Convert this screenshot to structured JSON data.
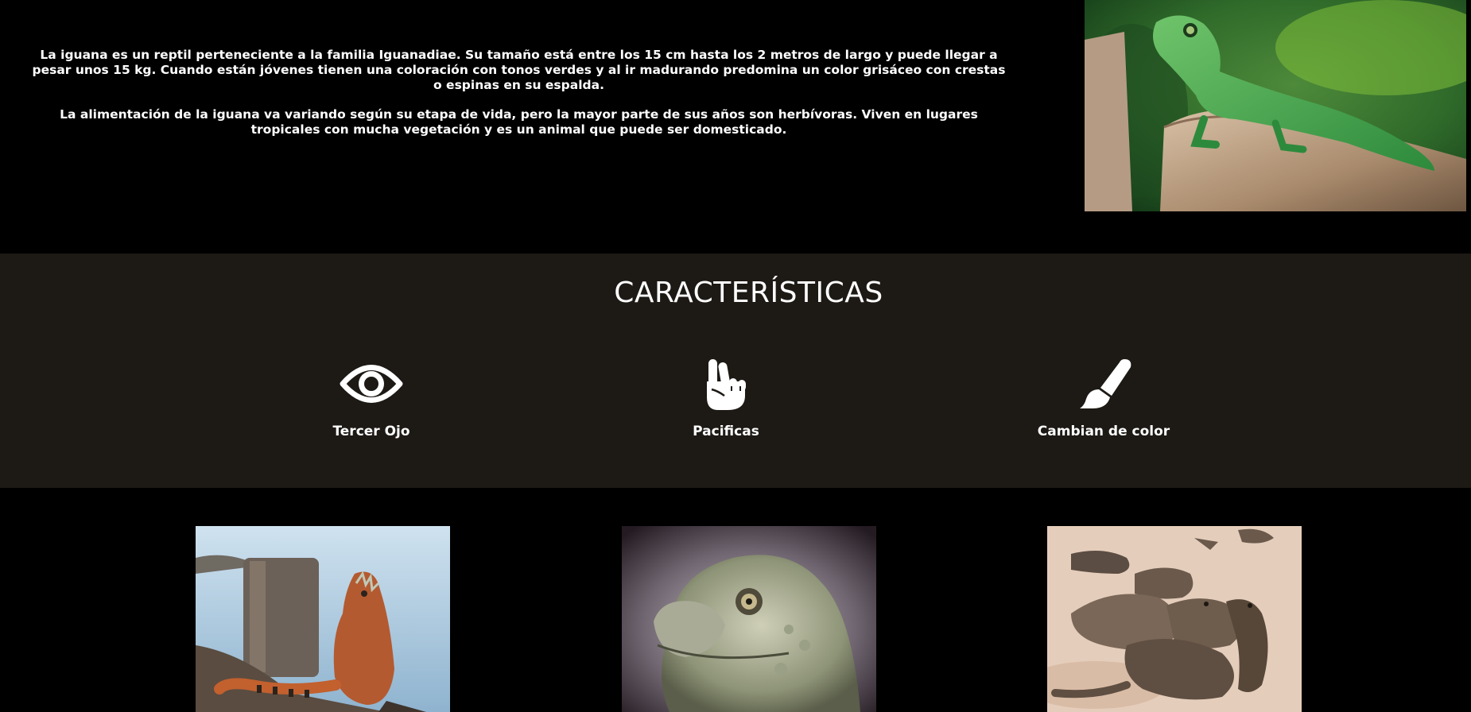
{
  "intro": {
    "paragraphs": [
      "La iguana es un reptil perteneciente a la familia Iguanadiae. Su tamaño está entre los 15 cm hasta los 2 metros de largo y puede llegar a pesar unos 15 kg. Cuando están jóvenes tienen una coloración con tonos verdes y al ir madurando predomina un color grisáceo con crestas o espinas en su espalda.",
      "La alimentación de la iguana va variando según su etapa de vida, pero la mayor parte de sus años son herbívoras. Viven en lugares tropicales con mucha vegetación y es un animal que puede ser domesticado."
    ]
  },
  "features": {
    "title": "CARACTERÍSTICAS",
    "items": [
      {
        "label": "Tercer Ojo",
        "icon": "eye-icon"
      },
      {
        "label": "Pacificas",
        "icon": "peace-hand-icon"
      },
      {
        "label": "Cambian de color",
        "icon": "paint-brush-icon"
      }
    ]
  },
  "colors": {
    "page_background": "#000000",
    "features_background": "#1d1915",
    "text": "#ffffff"
  }
}
